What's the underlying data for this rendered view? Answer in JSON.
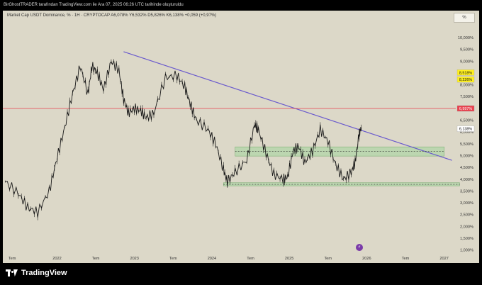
{
  "header": {
    "attribution": "BirGhostTRADER tarafından TradingView.com ile Ara 07, 2025 06:26 UTC tarihinde oluşturuldu"
  },
  "legend": {
    "text": "Market Cap USDT Dominance, % · 1H · CRYPTOCAP  A6,078%  Y6,532%  D5,826%  K6,138%  +0,059 (+0,97%)"
  },
  "unit_button": "%",
  "footer": {
    "brand": "TradingView"
  },
  "chart_data": {
    "type": "line",
    "title": "Market Cap USDT Dominance, %",
    "ylim": [
      0.6,
      10.6
    ],
    "y_ticks": [
      "10,000%",
      "9,500%",
      "9,000%",
      "8,500%",
      "8,000%",
      "7,500%",
      "7,000%",
      "6,500%",
      "6,000%",
      "5,500%",
      "5,000%",
      "4,500%",
      "4,000%",
      "3,500%",
      "3,000%",
      "2,500%",
      "2,000%",
      "1,500%",
      "1,000%"
    ],
    "x_ticks": [
      "Tem",
      "2022",
      "Tem",
      "2023",
      "Tem",
      "2024",
      "Tem",
      "2025",
      "Tem",
      "2026",
      "Tem",
      "2027"
    ],
    "price_labels": [
      {
        "text": "8,518%",
        "value": 8.518,
        "color": "#fff01f"
      },
      {
        "text": "8,226%",
        "value": 8.226,
        "color": "#fff01f"
      },
      {
        "text": "6,997%",
        "value": 6.997,
        "color": "#e8414e"
      },
      {
        "text": "6,138%",
        "value": 6.138,
        "color": "#ffffff"
      }
    ],
    "series": [
      {
        "x": [
          2021.33,
          2021.5,
          2021.62,
          2021.75,
          2021.9,
          2022.0,
          2022.1,
          2022.2,
          2022.3,
          2022.4,
          2022.45,
          2022.52,
          2022.6,
          2022.7,
          2022.8,
          2022.86,
          2022.92,
          2023.0,
          2023.08,
          2023.15,
          2023.25,
          2023.4,
          2023.55,
          2023.65,
          2023.72,
          2023.8,
          2023.95,
          2024.05,
          2024.15,
          2024.2,
          2024.3,
          2024.45,
          2024.55,
          2024.6,
          2024.7,
          2024.8,
          2024.92,
          2024.98,
          2025.05,
          2025.12,
          2025.2,
          2025.3,
          2025.4,
          2025.5,
          2025.6,
          2025.7,
          2025.8,
          2025.85,
          2025.9,
          2025.93
        ],
        "y": [
          3.9,
          3.4,
          2.8,
          2.6,
          3.5,
          4.9,
          6.2,
          7.6,
          8.8,
          7.6,
          8.8,
          8.5,
          7.8,
          9.0,
          8.6,
          7.4,
          6.8,
          7.0,
          6.9,
          6.6,
          6.8,
          8.3,
          8.4,
          7.9,
          7.2,
          6.5,
          6.1,
          5.5,
          4.4,
          3.9,
          4.3,
          4.8,
          6.3,
          6.1,
          5.1,
          4.2,
          4.0,
          4.1,
          5.2,
          5.4,
          4.7,
          5.2,
          6.1,
          5.6,
          4.6,
          4.0,
          4.3,
          4.7,
          5.9,
          6.2
        ],
        "color": "#1a1a1a"
      }
    ],
    "annotations": [
      {
        "kind": "trendline",
        "x": [
          2022.86,
          2027.1
        ],
        "y": [
          9.4,
          4.8
        ],
        "color": "#6a5acd"
      },
      {
        "kind": "hline",
        "y": 6.997,
        "color": "#e8414e"
      },
      {
        "kind": "zone",
        "x": [
          2024.3,
          2027.0
        ],
        "y": [
          4.98,
          5.37
        ],
        "color": "#a6d6a0"
      },
      {
        "kind": "dashed_hline",
        "x": [
          2024.3,
          2027.0
        ],
        "y": 5.18
      },
      {
        "kind": "zone",
        "x": [
          2024.15,
          2027.2
        ],
        "y": [
          3.72,
          3.85
        ],
        "color": "#a6d6a0"
      },
      {
        "kind": "dashed_hline",
        "x": [
          2024.15,
          2027.2
        ],
        "y": 3.78
      }
    ],
    "grid": false
  }
}
